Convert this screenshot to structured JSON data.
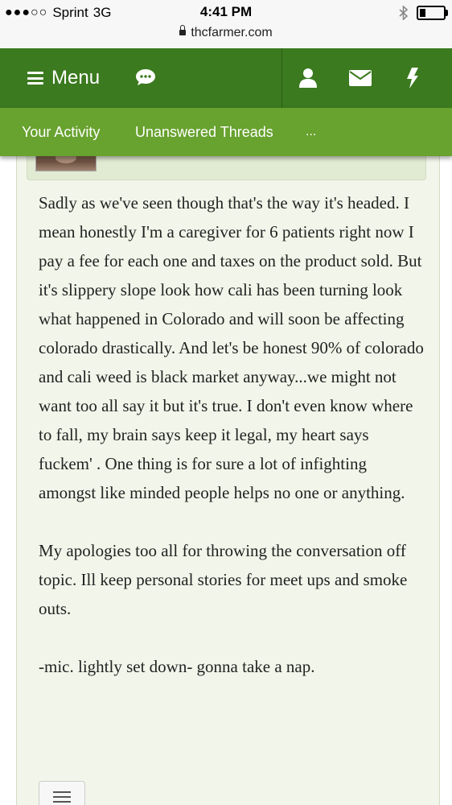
{
  "status_bar": {
    "signal_dots": "●●●○○",
    "carrier": "Sprint",
    "network": "3G",
    "time": "4:41 PM",
    "url": "thcfarmer.com",
    "battery_level": 0.25
  },
  "header": {
    "menu_label": "Menu",
    "icons": [
      "chat-icon",
      "user-icon",
      "envelope-icon",
      "lightning-icon"
    ],
    "bg_color": "#3b7a1f"
  },
  "tabs": {
    "items": [
      {
        "label": "Your Activity"
      },
      {
        "label": "Unanswered Threads"
      },
      {
        "label": "..."
      }
    ],
    "bg_color": "#68a22f"
  },
  "post": {
    "paragraphs": [
      "Sadly as we've seen though that's the way it's headed. I mean honestly I'm a caregiver for 6 patients right now I pay a fee for each one and taxes on the product sold. But it's slippery slope look how cali has been turning look what happened in Colorado and will soon be affecting colorado drastically. And let's be honest 90% of colorado and cali weed is black market anyway...we might not want too all say it but it's true. I don't even know where to fall, my brain says keep it legal, my heart says fuckem' . One thing is for sure a lot of infighting amongst like minded people helps no one or anything.",
      "My apologies too all for throwing the conversation off topic. Ill keep personal stories for meet ups and smoke outs.",
      "-mic. lightly set down- gonna take a nap."
    ]
  }
}
